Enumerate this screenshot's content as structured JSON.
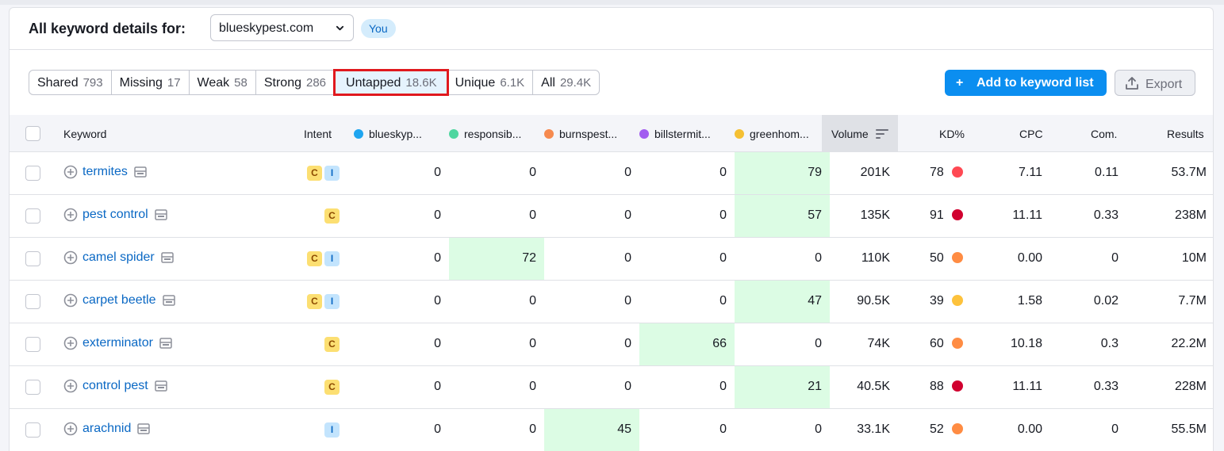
{
  "header": {
    "title": "All keyword details for:",
    "domain": "blueskypest.com",
    "you_badge": "You"
  },
  "tabs": [
    {
      "label": "Shared",
      "count": "793"
    },
    {
      "label": "Missing",
      "count": "17"
    },
    {
      "label": "Weak",
      "count": "58"
    },
    {
      "label": "Strong",
      "count": "286"
    },
    {
      "label": "Untapped",
      "count": "18.6K"
    },
    {
      "label": "Unique",
      "count": "6.1K"
    },
    {
      "label": "All",
      "count": "29.4K"
    }
  ],
  "active_tab": "Untapped",
  "actions": {
    "add_label": "Add to keyword list",
    "export_label": "Export"
  },
  "columns": {
    "keyword": "Keyword",
    "intent": "Intent",
    "d1": "blueskyp...",
    "d2": "responsib...",
    "d3": "burnspest...",
    "d4": "billstermit...",
    "d5": "greenhom...",
    "volume": "Volume",
    "kd": "KD%",
    "cpc": "CPC",
    "com": "Com.",
    "results": "Results"
  },
  "colors": {
    "accent": "#0b8ef0",
    "d1": "#1fa5f0",
    "d2": "#4fd6a0",
    "d3": "#f68a4f",
    "d4": "#a25cf0",
    "d5": "#f5c033",
    "highlight": "#dcfce4",
    "kd_very_hard": "#d1002f",
    "kd_hard": "#ff4953",
    "kd_difficult": "#ff8c43",
    "kd_possible": "#fdc23c"
  },
  "rows": [
    {
      "keyword": "termites",
      "intent": [
        "C",
        "I"
      ],
      "d1": "0",
      "d2": "0",
      "d3": "0",
      "d4": "0",
      "d5": "79",
      "best": 5,
      "volume": "201K",
      "kd": "78",
      "kd_level": "kd_hard",
      "cpc": "7.11",
      "com": "0.11",
      "results": "53.7M"
    },
    {
      "keyword": "pest control",
      "intent": [
        "C"
      ],
      "d1": "0",
      "d2": "0",
      "d3": "0",
      "d4": "0",
      "d5": "57",
      "best": 5,
      "volume": "135K",
      "kd": "91",
      "kd_level": "kd_very_hard",
      "cpc": "11.11",
      "com": "0.33",
      "results": "238M"
    },
    {
      "keyword": "camel spider",
      "intent": [
        "C",
        "I"
      ],
      "d1": "0",
      "d2": "72",
      "d3": "0",
      "d4": "0",
      "d5": "0",
      "best": 2,
      "volume": "110K",
      "kd": "50",
      "kd_level": "kd_difficult",
      "cpc": "0.00",
      "com": "0",
      "results": "10M"
    },
    {
      "keyword": "carpet beetle",
      "intent": [
        "C",
        "I"
      ],
      "d1": "0",
      "d2": "0",
      "d3": "0",
      "d4": "0",
      "d5": "47",
      "best": 5,
      "volume": "90.5K",
      "kd": "39",
      "kd_level": "kd_possible",
      "cpc": "1.58",
      "com": "0.02",
      "results": "7.7M"
    },
    {
      "keyword": "exterminator",
      "intent": [
        "C"
      ],
      "d1": "0",
      "d2": "0",
      "d3": "0",
      "d4": "66",
      "d5": "0",
      "best": 4,
      "volume": "74K",
      "kd": "60",
      "kd_level": "kd_difficult",
      "cpc": "10.18",
      "com": "0.3",
      "results": "22.2M"
    },
    {
      "keyword": "control pest",
      "intent": [
        "C"
      ],
      "d1": "0",
      "d2": "0",
      "d3": "0",
      "d4": "0",
      "d5": "21",
      "best": 5,
      "volume": "40.5K",
      "kd": "88",
      "kd_level": "kd_very_hard",
      "cpc": "11.11",
      "com": "0.33",
      "results": "228M"
    },
    {
      "keyword": "arachnid",
      "intent": [
        "I"
      ],
      "d1": "0",
      "d2": "0",
      "d3": "45",
      "d4": "0",
      "d5": "0",
      "best": 3,
      "volume": "33.1K",
      "kd": "52",
      "kd_level": "kd_difficult",
      "cpc": "0.00",
      "com": "0",
      "results": "55.5M"
    }
  ]
}
